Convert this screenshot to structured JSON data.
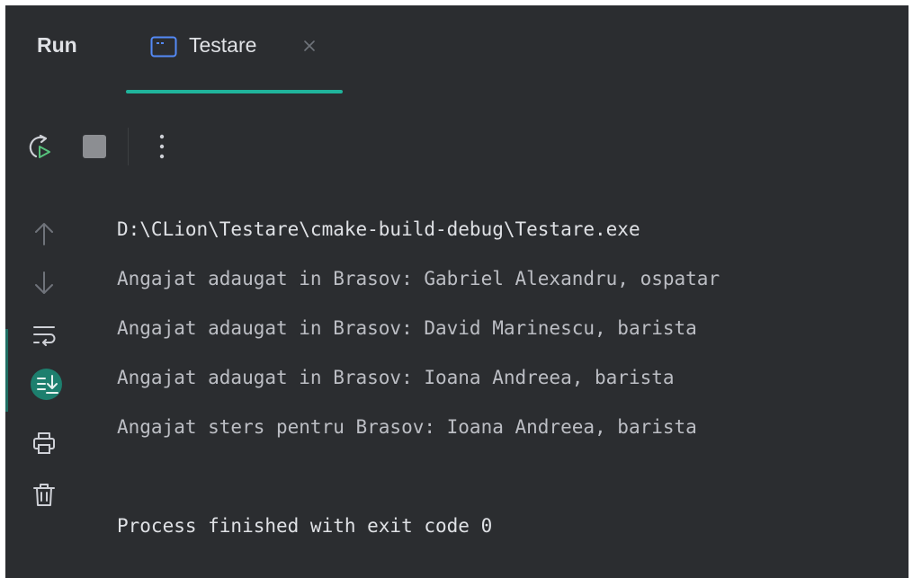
{
  "header": {
    "title": "Run",
    "tab": {
      "label": "Testare",
      "icon": "terminal-icon",
      "close_icon": "close-icon"
    },
    "accent_color": "#20b49c"
  },
  "toolbar": {
    "items": [
      {
        "name": "rerun-button",
        "icon": "rerun-icon"
      },
      {
        "name": "stop-button",
        "icon": "stop-icon"
      },
      {
        "name": "more-options-button",
        "icon": "more-vertical-icon"
      }
    ]
  },
  "sidebar": {
    "items": [
      {
        "name": "scroll-up-button",
        "icon": "arrow-up-icon"
      },
      {
        "name": "scroll-down-button",
        "icon": "arrow-down-icon"
      },
      {
        "name": "soft-wrap-button",
        "icon": "soft-wrap-icon"
      },
      {
        "name": "scroll-to-end-button",
        "icon": "scroll-to-end-icon",
        "active": true
      },
      {
        "name": "print-button",
        "icon": "printer-icon"
      },
      {
        "name": "clear-all-button",
        "icon": "trash-icon"
      }
    ]
  },
  "console": {
    "path": "D:\\CLion\\Testare\\cmake-build-debug\\Testare.exe",
    "lines": [
      "Angajat adaugat in Brasov: Gabriel Alexandru, ospatar",
      "Angajat adaugat in Brasov: David Marinescu, barista",
      "Angajat adaugat in Brasov: Ioana Andreea, barista",
      "Angajat sters pentru Brasov: Ioana Andreea, barista"
    ],
    "exit_message": "Process finished with exit code 0"
  }
}
